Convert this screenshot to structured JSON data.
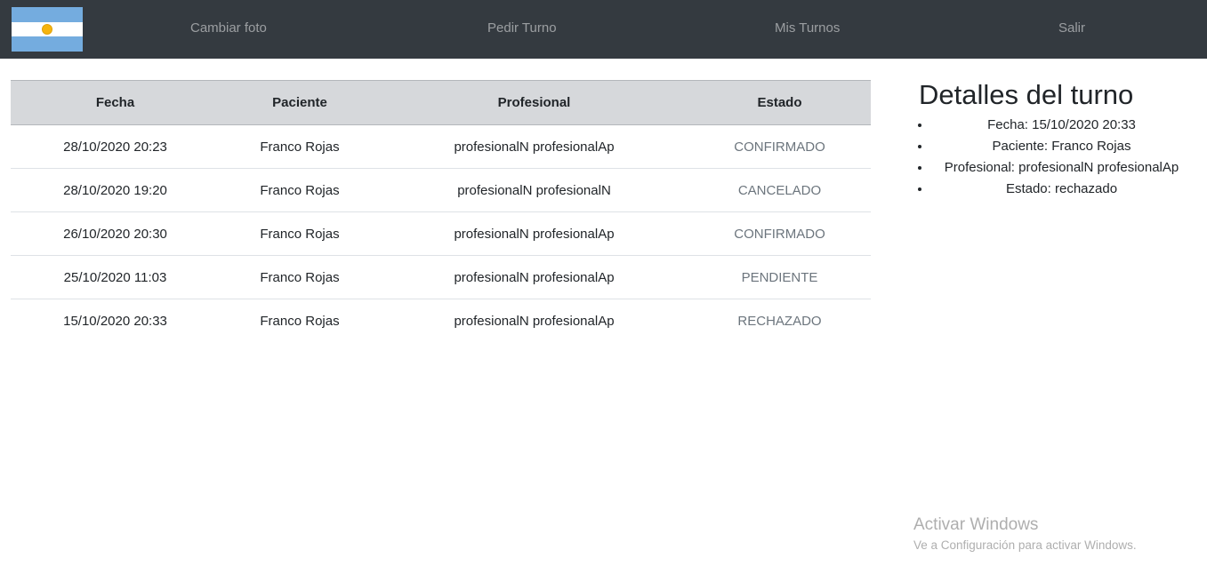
{
  "navbar": {
    "flag_icon": "argentina-flag",
    "links": [
      "Cambiar foto",
      "Pedir Turno",
      "Mis Turnos",
      "Salir"
    ]
  },
  "table": {
    "headers": [
      "Fecha",
      "Paciente",
      "Profesional",
      "Estado"
    ],
    "rows": [
      {
        "fecha": "28/10/2020 20:23",
        "paciente": "Franco Rojas",
        "profesional": "profesionalN profesionalAp",
        "estado": "CONFIRMADO"
      },
      {
        "fecha": "28/10/2020 19:20",
        "paciente": "Franco Rojas",
        "profesional": "profesionalN profesionalN",
        "estado": "CANCELADO"
      },
      {
        "fecha": "26/10/2020 20:30",
        "paciente": "Franco Rojas",
        "profesional": "profesionalN profesionalAp",
        "estado": "CONFIRMADO"
      },
      {
        "fecha": "25/10/2020 11:03",
        "paciente": "Franco Rojas",
        "profesional": "profesionalN profesionalAp",
        "estado": "PENDIENTE"
      },
      {
        "fecha": "15/10/2020 20:33",
        "paciente": "Franco Rojas",
        "profesional": "profesionalN profesionalAp",
        "estado": "RECHAZADO"
      }
    ]
  },
  "detalles": {
    "title": "Detalles del turno",
    "items": [
      "Fecha: 15/10/2020 20:33",
      "Paciente: Franco Rojas",
      "Profesional: profesionalN profesionalAp",
      "Estado: rechazado"
    ]
  },
  "watermark": {
    "line1": "Activar Windows",
    "line2": "Ve a Configuración para activar Windows."
  },
  "colors": {
    "navbar_bg": "#343a40",
    "table_header_bg": "#d6d8db",
    "estado_text": "#6c757d"
  }
}
